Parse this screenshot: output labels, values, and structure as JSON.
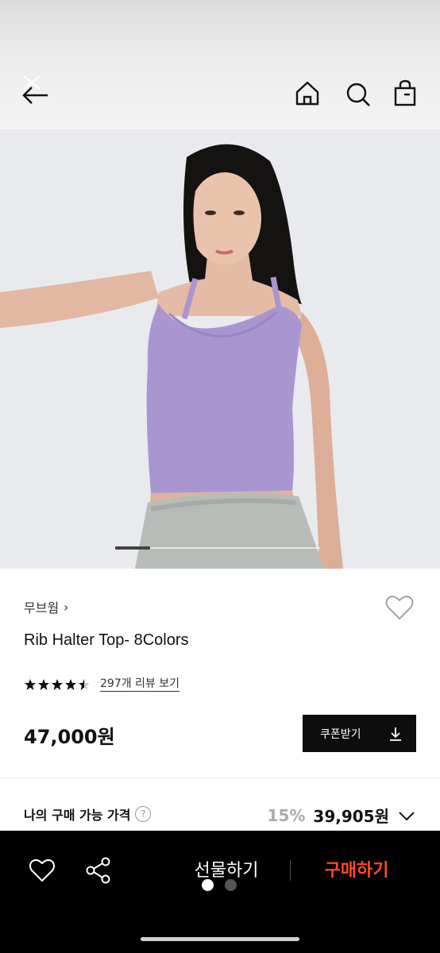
{
  "topbar": {
    "back_icon": "arrow-left-icon",
    "home_icon": "home-icon",
    "search_icon": "search-icon",
    "bag_icon": "shopping-bag-icon"
  },
  "hero": {
    "image": "model-in-lavender-halter-top",
    "carousel_position": 1
  },
  "product": {
    "brand": "무브웜",
    "brand_chevron": "›",
    "title": "Rib Halter Top- 8Colors",
    "rating": 4.5,
    "reviews_link": "297개 리뷰 보기",
    "price": "47,000원",
    "coupon_label": "쿠폰받기",
    "coupon_icon": "download-icon",
    "wishlist_icon": "heart-icon"
  },
  "my_price": {
    "label": "나의 구매 가능 가격",
    "help": "?",
    "discount": "15%",
    "final_price": "39,905원"
  },
  "bottom_bar": {
    "wish_icon": "heart-icon",
    "share_icon": "share-icon",
    "gift_label": "선물하기",
    "buy_label": "구매하기",
    "buy_color": "#ff4a17",
    "page_dots": 2,
    "active_dot": 1
  }
}
